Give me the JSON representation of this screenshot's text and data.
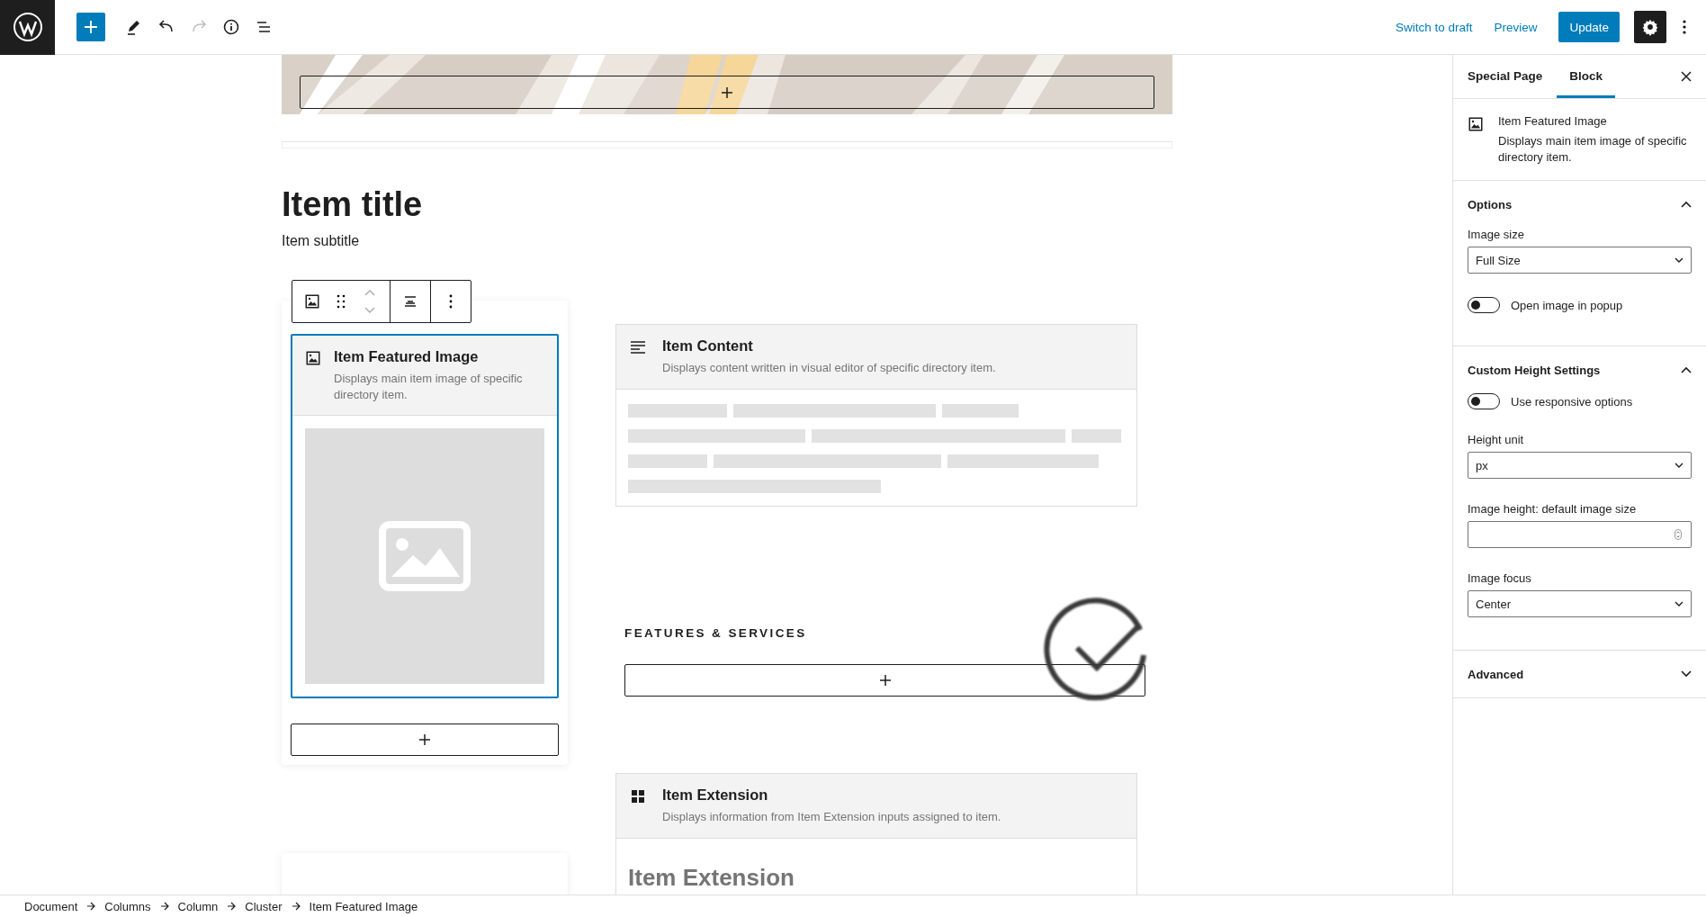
{
  "header": {
    "tools": [
      {
        "kind": "add",
        "disabled": false
      },
      {
        "kind": "edit",
        "disabled": false
      },
      {
        "kind": "undo",
        "disabled": false
      },
      {
        "kind": "redo",
        "disabled": true
      },
      {
        "kind": "info",
        "disabled": false
      },
      {
        "kind": "list",
        "disabled": false
      }
    ],
    "links": [
      "Switch to draft",
      "Preview"
    ],
    "update": "Update",
    "settings_active": true
  },
  "canvas": {
    "title": "Item title",
    "subtitle": "Item subtitle",
    "featured_block": {
      "title": "Item Featured Image",
      "description": "Displays main item image of specific directory item.",
      "selected": true
    },
    "content_block": {
      "title": "Item Content",
      "description": "Displays content written in visual editor of specific directory item."
    },
    "features_heading": "FEATURES & SERVICES",
    "extension_block": {
      "title": "Item Extension",
      "description": "Displays information from Item Extension inputs assigned to item.",
      "preview_heading": "Item Extension"
    }
  },
  "sidebar": {
    "tabs": [
      {
        "label": "Special Page",
        "selected": false
      },
      {
        "label": "Block",
        "selected": true
      }
    ],
    "block": {
      "title": "Item Featured Image",
      "description": "Displays main item image of specific directory item."
    },
    "panels": [
      {
        "title": "Options",
        "expanded": true,
        "fields": [
          {
            "kind": "select",
            "label": "Image size",
            "value": "Full Size"
          },
          {
            "kind": "toggle",
            "label": "Open image in popup",
            "on": false
          }
        ]
      },
      {
        "title": "Custom Height Settings",
        "expanded": true,
        "fields": [
          {
            "kind": "toggle",
            "label": "Use responsive options",
            "on": false
          },
          {
            "kind": "select",
            "label": "Height unit",
            "value": "px"
          },
          {
            "kind": "number",
            "label": "Image height: default image size"
          },
          {
            "kind": "select",
            "label": "Image focus",
            "value": "Center"
          }
        ]
      },
      {
        "title": "Advanced",
        "expanded": false
      }
    ]
  },
  "breadcrumbs": [
    "Document",
    "Columns",
    "Column",
    "Cluster",
    "Item Featured Image"
  ]
}
